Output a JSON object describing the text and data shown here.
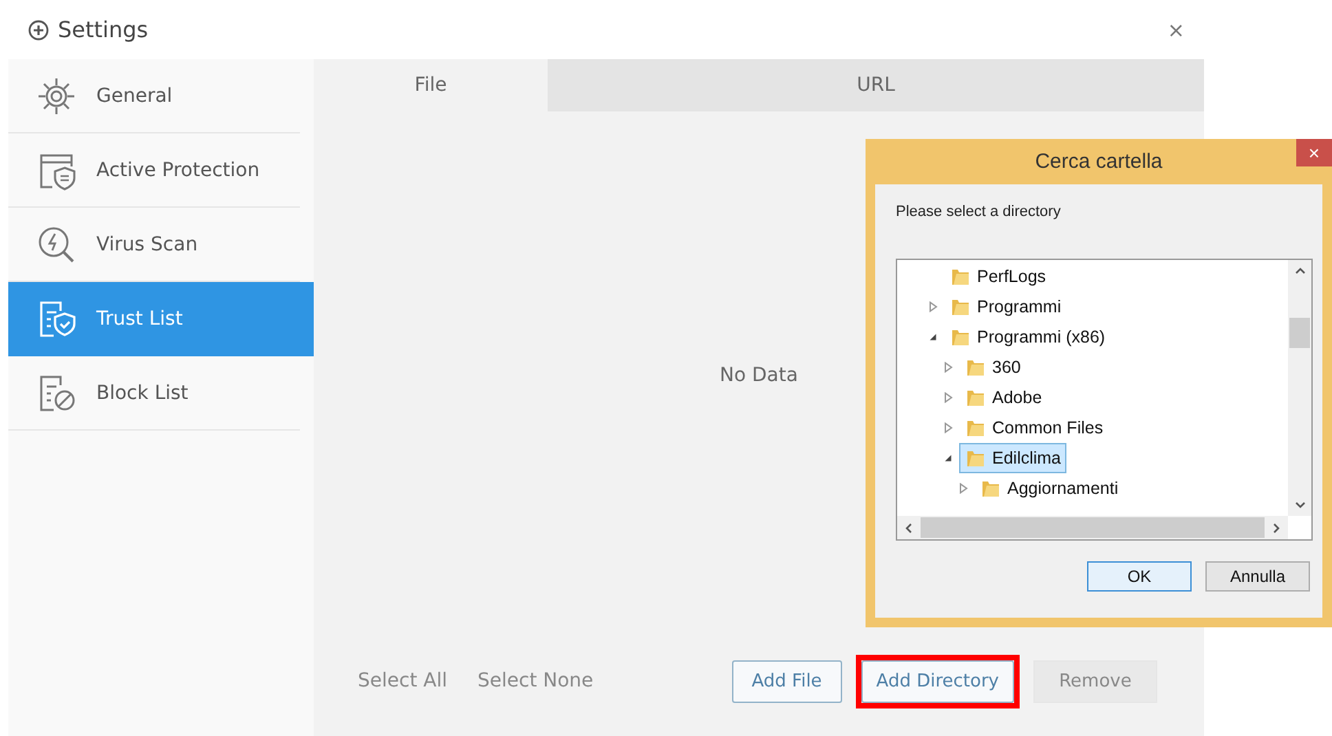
{
  "window": {
    "title": "Settings",
    "close": "×"
  },
  "sidebar": {
    "items": [
      {
        "label": "General",
        "selected": false
      },
      {
        "label": "Active Protection",
        "selected": false
      },
      {
        "label": "Virus Scan",
        "selected": false
      },
      {
        "label": "Trust List",
        "selected": true
      },
      {
        "label": "Block List",
        "selected": false
      }
    ]
  },
  "tabs": [
    {
      "label": "File",
      "selected": true
    },
    {
      "label": "URL",
      "selected": false
    }
  ],
  "empty_message": "No Data",
  "footer": {
    "links": [
      "Select All",
      "Select None"
    ],
    "buttons": [
      {
        "label": "Add File",
        "kind": "outline",
        "highlighted": false
      },
      {
        "label": "Add Directory",
        "kind": "outline",
        "highlighted": true
      },
      {
        "label": "Remove",
        "kind": "disabled",
        "highlighted": false
      }
    ]
  },
  "dialog": {
    "title": "Cerca cartella",
    "close": "×",
    "prompt": "Please select a directory",
    "tree": [
      {
        "label": "PerfLogs",
        "kind": "leaf",
        "selected": false
      },
      {
        "label": "Programmi",
        "kind": "branch",
        "expanded": false,
        "selected": false
      },
      {
        "label": "Programmi (x86)",
        "kind": "branch",
        "expanded": true,
        "selected": false,
        "children": [
          {
            "label": "360",
            "kind": "branch",
            "expanded": false,
            "selected": false
          },
          {
            "label": "Adobe",
            "kind": "branch",
            "expanded": false,
            "selected": false
          },
          {
            "label": "Common Files",
            "kind": "branch",
            "expanded": false,
            "selected": false
          },
          {
            "label": "Edilclima",
            "kind": "branch",
            "expanded": true,
            "selected": true,
            "children": [
              {
                "label": "Aggiornamenti",
                "kind": "branch",
                "expanded": false,
                "selected": false
              }
            ]
          }
        ]
      }
    ],
    "buttons": [
      {
        "label": "OK",
        "kind": "default"
      },
      {
        "label": "Annulla",
        "kind": "normal"
      }
    ]
  }
}
